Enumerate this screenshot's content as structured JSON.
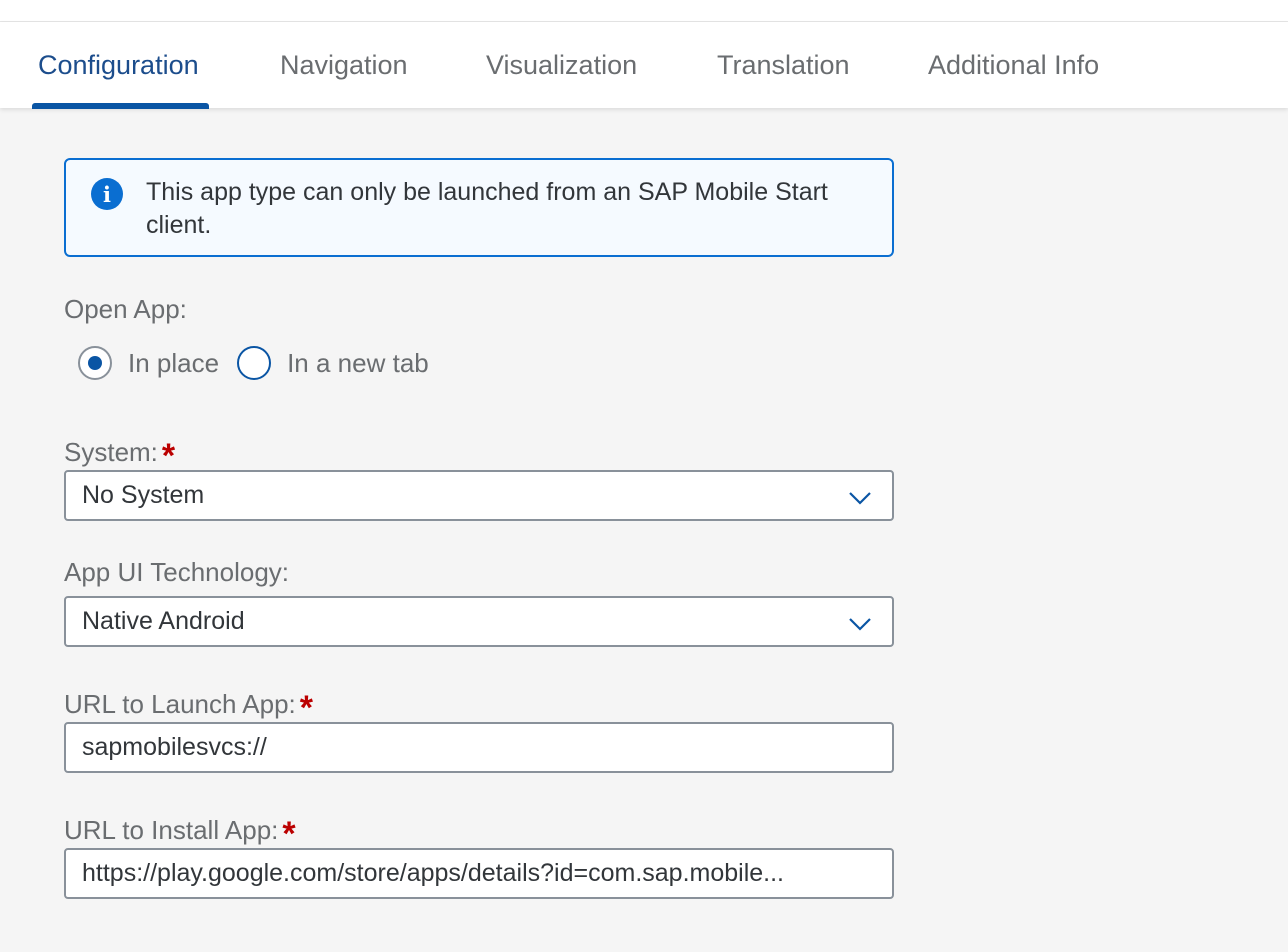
{
  "tabs": [
    {
      "label": "Configuration",
      "active": true
    },
    {
      "label": "Navigation",
      "active": false
    },
    {
      "label": "Visualization",
      "active": false
    },
    {
      "label": "Translation",
      "active": false
    },
    {
      "label": "Additional Info",
      "active": false
    }
  ],
  "info_strip": {
    "icon": "info-icon",
    "text": "This app type can only be launched from an SAP Mobile Start client."
  },
  "open_app": {
    "label": "Open App:",
    "options": [
      {
        "label": "In place",
        "selected": true
      },
      {
        "label": "In a new tab",
        "selected": false
      }
    ]
  },
  "system": {
    "label": "System:",
    "required": true,
    "value": "No System"
  },
  "ui_technology": {
    "label": "App UI Technology:",
    "value": "Native Android"
  },
  "launch_url": {
    "label": "URL to Launch App:",
    "required": true,
    "value": "sapmobilesvcs://"
  },
  "install_url": {
    "label": "URL to Install App:",
    "required": true,
    "value": "https://play.google.com/store/apps/details?id=com.sap.mobile..."
  },
  "required_marker": "*",
  "colors": {
    "accent": "#0a6ed1",
    "active_tab": "#1c4d8c",
    "required": "#bb0000",
    "info_background": "#f5faff"
  }
}
